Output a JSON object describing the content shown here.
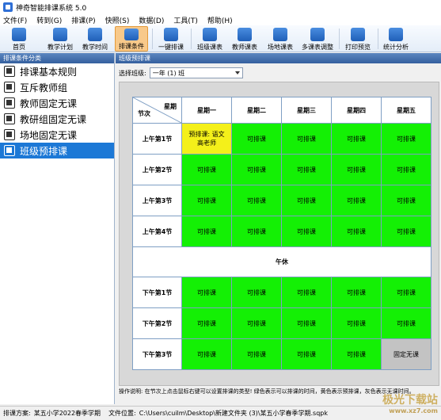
{
  "window": {
    "title": "神奇智能排课系统 5.0"
  },
  "menu": [
    "文件(F)",
    "转到(G)",
    "排课(P)",
    "快照(S)",
    "数据(D)",
    "工具(T)",
    "帮助(H)"
  ],
  "toolbar": [
    {
      "label": "首页",
      "icon": "home-icon"
    },
    {
      "label": "教学计划",
      "icon": "clipboard-icon"
    },
    {
      "label": "教学时间",
      "icon": "clock-icon"
    },
    {
      "label": "排课条件",
      "icon": "settings-cluster-icon",
      "active": true
    },
    {
      "label": "一键排课",
      "icon": "hand-pointer-icon"
    },
    {
      "label": "班级课表",
      "icon": "calendar-icon"
    },
    {
      "label": "教师课表",
      "icon": "teacher-icon"
    },
    {
      "label": "场地课表",
      "icon": "building-icon"
    },
    {
      "label": "多课表调整",
      "icon": "adjust-icon"
    },
    {
      "label": "打印预览",
      "icon": "printer-icon"
    },
    {
      "label": "统计分析",
      "icon": "bar-chart-icon"
    }
  ],
  "left_panel": {
    "header": "排课条件分类",
    "items": [
      {
        "label": "排课基本规则",
        "icon": "rules-icon"
      },
      {
        "label": "互斥教师组",
        "icon": "group-icon"
      },
      {
        "label": "教师固定无课",
        "icon": "teacher-lock-icon"
      },
      {
        "label": "教研组固定无课",
        "icon": "team-lock-icon"
      },
      {
        "label": "场地固定无课",
        "icon": "venue-icon"
      },
      {
        "label": "班级预排课",
        "icon": "class-icon",
        "selected": true
      }
    ]
  },
  "right_panel": {
    "header": "班级预排课",
    "select_label": "选择班级:",
    "select_value": "一年 (1) 班"
  },
  "schedule": {
    "corner_top": "星期",
    "corner_bottom": "节次",
    "days": [
      "星期一",
      "星期二",
      "星期三",
      "星期四",
      "星期五"
    ],
    "lunch": "午休",
    "morning": [
      {
        "period": "上午第1节",
        "cells": [
          {
            "text": "预排课: 语文\n高老师",
            "status": "yellow"
          },
          {
            "text": "可排课",
            "status": "green"
          },
          {
            "text": "可排课",
            "status": "green"
          },
          {
            "text": "可排课",
            "status": "green"
          },
          {
            "text": "可排课",
            "status": "green"
          }
        ]
      },
      {
        "period": "上午第2节",
        "cells": [
          {
            "text": "可排课",
            "status": "green"
          },
          {
            "text": "可排课",
            "status": "green"
          },
          {
            "text": "可排课",
            "status": "green"
          },
          {
            "text": "可排课",
            "status": "green"
          },
          {
            "text": "可排课",
            "status": "green"
          }
        ]
      },
      {
        "period": "上午第3节",
        "cells": [
          {
            "text": "可排课",
            "status": "green"
          },
          {
            "text": "可排课",
            "status": "green"
          },
          {
            "text": "可排课",
            "status": "green"
          },
          {
            "text": "可排课",
            "status": "green"
          },
          {
            "text": "可排课",
            "status": "green"
          }
        ]
      },
      {
        "period": "上午第4节",
        "cells": [
          {
            "text": "可排课",
            "status": "green"
          },
          {
            "text": "可排课",
            "status": "green"
          },
          {
            "text": "可排课",
            "status": "green"
          },
          {
            "text": "可排课",
            "status": "green"
          },
          {
            "text": "可排课",
            "status": "green"
          }
        ]
      }
    ],
    "afternoon": [
      {
        "period": "下午第1节",
        "cells": [
          {
            "text": "可排课",
            "status": "green"
          },
          {
            "text": "可排课",
            "status": "green"
          },
          {
            "text": "可排课",
            "status": "green"
          },
          {
            "text": "可排课",
            "status": "green"
          },
          {
            "text": "可排课",
            "status": "green"
          }
        ]
      },
      {
        "period": "下午第2节",
        "cells": [
          {
            "text": "可排课",
            "status": "green"
          },
          {
            "text": "可排课",
            "status": "green"
          },
          {
            "text": "可排课",
            "status": "green"
          },
          {
            "text": "可排课",
            "status": "green"
          },
          {
            "text": "可排课",
            "status": "green"
          }
        ]
      },
      {
        "period": "下午第3节",
        "cells": [
          {
            "text": "可排课",
            "status": "green"
          },
          {
            "text": "可排课",
            "status": "green"
          },
          {
            "text": "可排课",
            "status": "green"
          },
          {
            "text": "可排课",
            "status": "green"
          },
          {
            "text": "固定无课",
            "status": "gray"
          }
        ]
      }
    ]
  },
  "instructions": "操作说明: 在节次上点击鼠标右键可以设置排课的类型! 绿色表示可以排课的时间，黄色表示预排课，灰色表示无课时间。",
  "status": {
    "scheme_label": "排课方案:",
    "scheme_value": "某五小学2022春季学期",
    "path_label": "文件位置:",
    "path_value": "C:\\Users\\cuilm\\Desktop\\新建文件夹 (3)\\某五小学春季学期.sqpk"
  },
  "watermark": {
    "main": "极光下载站",
    "sub": "www.xz7.com"
  },
  "colors": {
    "green": "#14f005",
    "yellow": "#f4f01a",
    "gray": "#c3c3c3",
    "accent": "#1c78d6"
  }
}
